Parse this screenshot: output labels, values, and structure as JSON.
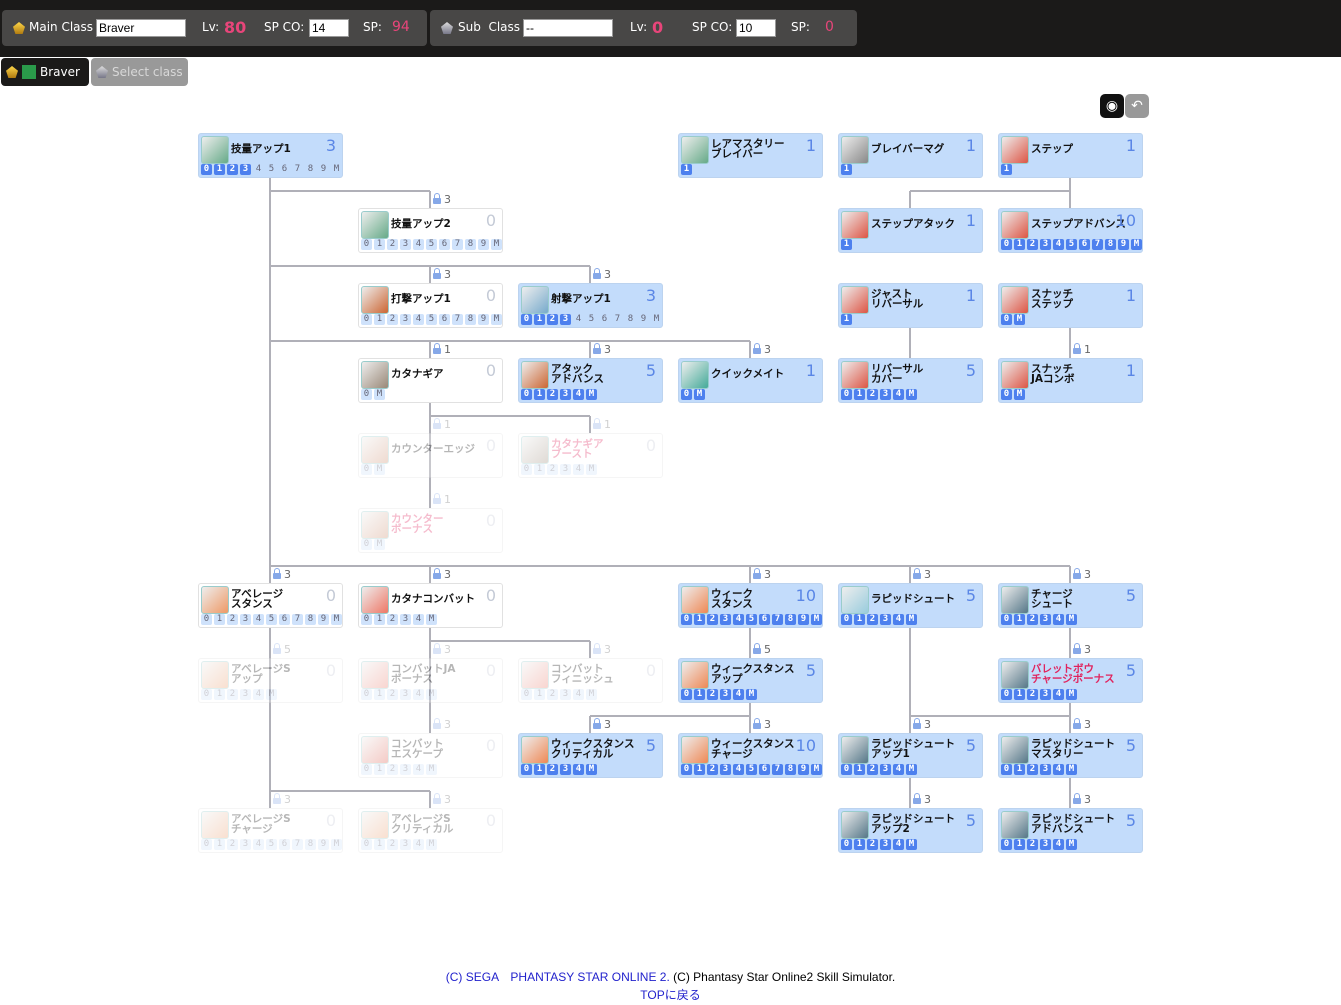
{
  "header": {
    "main": {
      "label": "Main Class",
      "class_value": "Braver",
      "lv_label": "Lv:",
      "lv": "80",
      "spco_label": "SP CO:",
      "spco": "14",
      "sp_label": "SP:",
      "sp": "94"
    },
    "sub": {
      "label": "Sub  Class",
      "class_value": "--",
      "lv_label": "Lv:",
      "lv": "0",
      "spco_label": "SP CO:",
      "spco": "10",
      "sp_label": "SP:",
      "sp": "0"
    }
  },
  "tabs": [
    {
      "label": "Braver",
      "active": true
    },
    {
      "label": "Select class",
      "active": false
    }
  ],
  "tools": {
    "camera": "camera-icon",
    "back": "undo-icon"
  },
  "colors": {
    "learned_bg": "#c3dcfb",
    "pip_on": "#4d80ee",
    "level": "#5a86e6",
    "pink": "#e0245e",
    "accent_lv": "#e8457a"
  },
  "nodes": [
    {
      "name": "技量アップ1",
      "level": "3",
      "pips": [
        "0",
        "1",
        "2",
        "3",
        "4",
        "5",
        "6",
        "7",
        "8",
        "9",
        "M"
      ],
      "state": "learned",
      "icon": "#6a8"
    },
    {
      "name": "レアマスタリー\nブレイバー",
      "level": "1",
      "pips": [
        "1"
      ],
      "state": "learned",
      "icon": "#6a8"
    },
    {
      "name": "ブレイバーマグ",
      "level": "1",
      "pips": [
        "1"
      ],
      "state": "learned",
      "icon": "#888"
    },
    {
      "name": "ステップ",
      "level": "1",
      "pips": [
        "1"
      ],
      "state": "learned",
      "icon": "#d54"
    },
    {
      "name": "技量アップ2",
      "level": "0",
      "pips": [
        "0",
        "1",
        "2",
        "3",
        "4",
        "5",
        "6",
        "7",
        "8",
        "9",
        "M"
      ],
      "state": "open",
      "lock": "3",
      "icon": "#6a8"
    },
    {
      "name": "ステップアタック",
      "level": "1",
      "pips": [
        "1"
      ],
      "state": "learned",
      "icon": "#d54"
    },
    {
      "name": "ステップアドバンス",
      "level": "10",
      "pips": [
        "0",
        "1",
        "2",
        "3",
        "4",
        "5",
        "6",
        "7",
        "8",
        "9",
        "M"
      ],
      "state": "learned",
      "icon": "#d54"
    },
    {
      "name": "打撃アップ1",
      "level": "0",
      "pips": [
        "0",
        "1",
        "2",
        "3",
        "4",
        "5",
        "6",
        "7",
        "8",
        "9",
        "M"
      ],
      "state": "open",
      "lock": "3",
      "icon": "#c63"
    },
    {
      "name": "射撃アップ1",
      "level": "3",
      "pips": [
        "0",
        "1",
        "2",
        "3",
        "4",
        "5",
        "6",
        "7",
        "8",
        "9",
        "M"
      ],
      "state": "learned",
      "lock": "3",
      "icon": "#7ac"
    },
    {
      "name": "ジャスト\nリバーサル",
      "level": "1",
      "pips": [
        "1"
      ],
      "state": "learned",
      "icon": "#d54"
    },
    {
      "name": "スナッチ\nステップ",
      "level": "1",
      "pips": [
        "0",
        "M"
      ],
      "state": "learned",
      "icon": "#d54"
    },
    {
      "name": "カタナギア",
      "level": "0",
      "pips": [
        "0",
        "M"
      ],
      "state": "open",
      "lock": "1",
      "icon": "#987"
    },
    {
      "name": "アタック\nアドバンス",
      "level": "5",
      "pips": [
        "0",
        "1",
        "2",
        "3",
        "4",
        "M"
      ],
      "state": "learned",
      "lock": "3",
      "icon": "#c63"
    },
    {
      "name": "クイックメイト",
      "level": "1",
      "pips": [
        "0",
        "M"
      ],
      "state": "learned",
      "lock": "3",
      "icon": "#4a9"
    },
    {
      "name": "リバーサル\nカバー",
      "level": "5",
      "pips": [
        "0",
        "1",
        "2",
        "3",
        "4",
        "M"
      ],
      "state": "learned",
      "icon": "#d54"
    },
    {
      "name": "スナッチ\nJAコンボ",
      "level": "1",
      "pips": [
        "0",
        "M"
      ],
      "state": "learned",
      "lock": "1",
      "icon": "#d54"
    },
    {
      "name": "カウンターエッジ",
      "level": "0",
      "pips": [
        "0",
        "M"
      ],
      "state": "disabled",
      "lock": "1",
      "icon": "#c86"
    },
    {
      "name": "カタナギア\nブースト",
      "level": "0",
      "pips": [
        "0",
        "1",
        "2",
        "3",
        "4",
        "M"
      ],
      "state": "disabled",
      "lock": "1",
      "pink": true,
      "icon": "#987"
    },
    {
      "name": "カウンター\nボーナス",
      "level": "0",
      "pips": [
        "0",
        "M"
      ],
      "state": "disabled",
      "lock": "1",
      "pink": true,
      "icon": "#c86"
    },
    {
      "name": "アベレージ\nスタンス",
      "level": "0",
      "pips": [
        "0",
        "1",
        "2",
        "3",
        "4",
        "5",
        "6",
        "7",
        "8",
        "9",
        "M"
      ],
      "state": "open",
      "lock": "3",
      "icon": "#e96"
    },
    {
      "name": "カタナコンバット",
      "level": "0",
      "pips": [
        "0",
        "1",
        "2",
        "3",
        "4",
        "M"
      ],
      "state": "open",
      "lock": "3",
      "icon": "#e76"
    },
    {
      "name": "ウィーク\nスタンス",
      "level": "10",
      "pips": [
        "0",
        "1",
        "2",
        "3",
        "4",
        "5",
        "6",
        "7",
        "8",
        "9",
        "M"
      ],
      "state": "learned",
      "lock": "3",
      "icon": "#e85"
    },
    {
      "name": "ラピッドシュート",
      "level": "5",
      "pips": [
        "0",
        "1",
        "2",
        "3",
        "4",
        "M"
      ],
      "state": "learned",
      "lock": "3",
      "icon": "#9cd"
    },
    {
      "name": "チャージ\nシュート",
      "level": "5",
      "pips": [
        "0",
        "1",
        "2",
        "3",
        "4",
        "M"
      ],
      "state": "learned",
      "lock": "3",
      "icon": "#578"
    },
    {
      "name": "アベレージS\nアップ",
      "level": "0",
      "pips": [
        "0",
        "1",
        "2",
        "3",
        "4",
        "M"
      ],
      "state": "disabled",
      "lock": "5",
      "icon": "#e96"
    },
    {
      "name": "コンバットJA\nボーナス",
      "level": "0",
      "pips": [
        "0",
        "1",
        "2",
        "3",
        "4",
        "M"
      ],
      "state": "disabled",
      "lock": "3",
      "icon": "#e76"
    },
    {
      "name": "コンバット\nフィニッシュ",
      "level": "0",
      "pips": [
        "0",
        "1",
        "2",
        "3",
        "4",
        "M"
      ],
      "state": "disabled",
      "lock": "3",
      "icon": "#e76"
    },
    {
      "name": "ウィークスタンス\nアップ",
      "level": "5",
      "pips": [
        "0",
        "1",
        "2",
        "3",
        "4",
        "M"
      ],
      "state": "learned",
      "lock": "5",
      "icon": "#e85"
    },
    {
      "name": "バレットボウ\nチャージボーナス",
      "level": "5",
      "pips": [
        "0",
        "1",
        "2",
        "3",
        "4",
        "M"
      ],
      "state": "learned",
      "lock": "3",
      "pink": true,
      "icon": "#578"
    },
    {
      "name": "コンバット\nエスケープ",
      "level": "0",
      "pips": [
        "0",
        "1",
        "2",
        "3",
        "4",
        "M"
      ],
      "state": "disabled",
      "lock": "3",
      "icon": "#d54"
    },
    {
      "name": "ウィークスタンス\nクリティカル",
      "level": "5",
      "pips": [
        "0",
        "1",
        "2",
        "3",
        "4",
        "M"
      ],
      "state": "learned",
      "lock": "3",
      "icon": "#e85"
    },
    {
      "name": "ウィークスタンス\nチャージ",
      "level": "10",
      "pips": [
        "0",
        "1",
        "2",
        "3",
        "4",
        "5",
        "6",
        "7",
        "8",
        "9",
        "M"
      ],
      "state": "learned",
      "lock": "3",
      "icon": "#e85"
    },
    {
      "name": "ラピッドシュート\nアップ1",
      "level": "5",
      "pips": [
        "0",
        "1",
        "2",
        "3",
        "4",
        "M"
      ],
      "state": "learned",
      "lock": "3",
      "icon": "#578"
    },
    {
      "name": "ラピッドシュート\nマスタリー",
      "level": "5",
      "pips": [
        "0",
        "1",
        "2",
        "3",
        "4",
        "M"
      ],
      "state": "learned",
      "lock": "3",
      "icon": "#578"
    },
    {
      "name": "アベレージS\nチャージ",
      "level": "0",
      "pips": [
        "0",
        "1",
        "2",
        "3",
        "4",
        "5",
        "6",
        "7",
        "8",
        "9",
        "M"
      ],
      "state": "disabled",
      "lock": "3",
      "icon": "#e96"
    },
    {
      "name": "アベレージS\nクリティカル",
      "level": "0",
      "pips": [
        "0",
        "1",
        "2",
        "3",
        "4",
        "M"
      ],
      "state": "disabled",
      "lock": "3",
      "icon": "#e96"
    },
    {
      "name": "ラピッドシュート\nアップ2",
      "level": "5",
      "pips": [
        "0",
        "1",
        "2",
        "3",
        "4",
        "M"
      ],
      "state": "learned",
      "lock": "3",
      "icon": "#578"
    },
    {
      "name": "ラピッドシュート\nアドバンス",
      "level": "5",
      "pips": [
        "0",
        "1",
        "2",
        "3",
        "4",
        "M"
      ],
      "state": "learned",
      "lock": "3",
      "icon": "#578"
    }
  ],
  "footer": {
    "sega": "(C) SEGA　PHANTASY STAR ONLINE 2.",
    "sim": "(C) Phantasy Star Online2 Skill Simulator.",
    "top": "TOPに戻る"
  }
}
